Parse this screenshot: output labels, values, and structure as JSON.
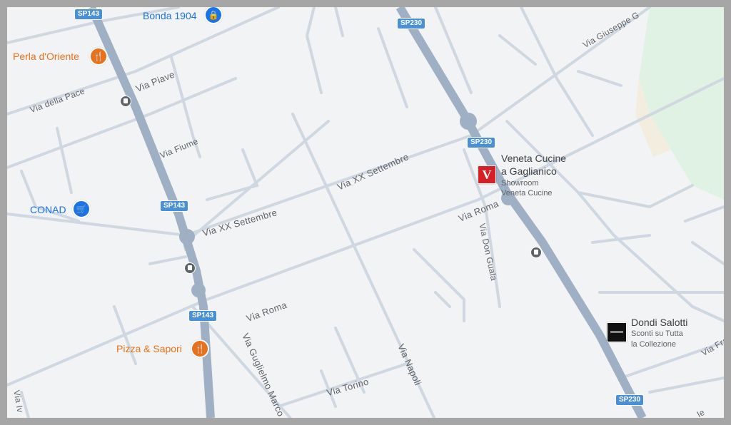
{
  "colors": {
    "frame": "#a6a6a6",
    "land": "#f2f3f4",
    "road": "#cfd8e1",
    "highway": "#9fb0c4",
    "park": "#dff2e3",
    "blue_poi": "#1a73e8",
    "orange_poi": "#e8711a",
    "shield": "#4a90d9"
  },
  "icons": {
    "bonda": "lock-bag-icon",
    "restaurant": "fork-knife-icon",
    "supermarket": "shopping-cart-icon",
    "veneta": "veneta-cucine-logo",
    "dondi": "dondi-salotti-logo",
    "bus": "bus-stop-icon"
  },
  "shields": {
    "sp143_top": "SP143",
    "sp143_mid": "SP143",
    "sp143_low": "SP143",
    "sp230_top": "SP230",
    "sp230_mid": "SP230",
    "sp230_bottom": "SP230"
  },
  "streets": {
    "via_piave": "Via Piave",
    "via_della_pace": "Via della Pace",
    "via_fiume": "Via Fiume",
    "via_xx_settembre_1": "Via XX Settembre",
    "via_xx_settembre_2": "Via XX Settembre",
    "via_roma_1": "Via Roma",
    "via_roma_2": "Via Roma",
    "via_don_guala": "Via Don Guala",
    "via_guglielmo_marconi": "Via Guglielmo Marco",
    "via_napoli": "Via Napoli",
    "via_torino": "Via Torino",
    "via_giuseppe": "Via Giuseppe G",
    "via_fra": "Via Fra",
    "via_iv": "Via Iv",
    "via_le": "le"
  },
  "pois": {
    "bonda": "Bonda 1904",
    "perla": "Perla d'Oriente",
    "conad": "CONAD",
    "pizza": "Pizza & Sapori",
    "veneta_title_1": "Veneta Cucine",
    "veneta_title_2": "a Gaglianico",
    "veneta_sub_1": "Showroom",
    "veneta_sub_2": "Veneta Cucine",
    "veneta_logo_letter": "V",
    "dondi_title": "Dondi Salotti",
    "dondi_sub_1": "Sconti su Tutta",
    "dondi_sub_2": "la Collezione"
  }
}
